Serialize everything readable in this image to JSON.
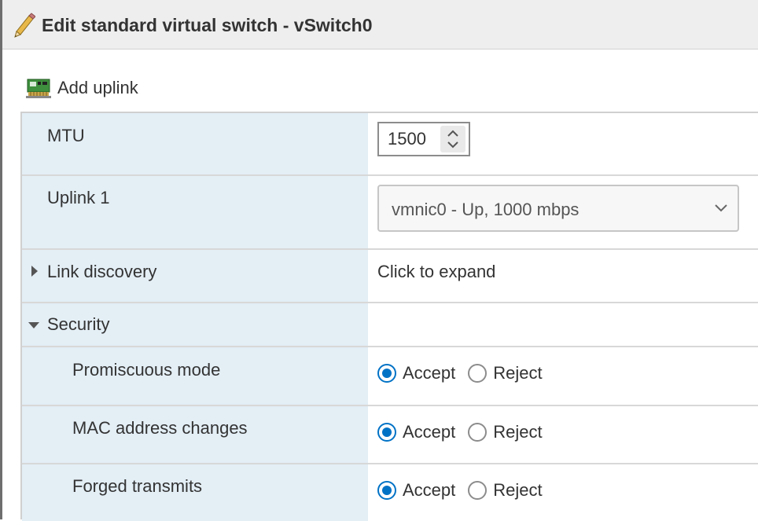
{
  "dialog": {
    "title": "Edit standard virtual switch - vSwitch0",
    "title_icon": "pencil-icon"
  },
  "toolbar": {
    "add_uplink_label": "Add uplink",
    "add_uplink_icon": "network-card-icon"
  },
  "settings": {
    "mtu": {
      "label": "MTU",
      "value": "1500"
    },
    "uplink1": {
      "label": "Uplink 1",
      "selected": "vmnic0 - Up, 1000 mbps"
    },
    "link_discovery": {
      "label": "Link discovery",
      "value": "Click to expand",
      "expanded": false
    },
    "security": {
      "label": "Security",
      "expanded": true,
      "rows": [
        {
          "label": "Promiscuous mode",
          "accept": "Accept",
          "reject": "Reject",
          "selected": "Accept"
        },
        {
          "label": "MAC address changes",
          "accept": "Accept",
          "reject": "Reject",
          "selected": "Accept"
        },
        {
          "label": "Forged transmits",
          "accept": "Accept",
          "reject": "Reject",
          "selected": "Accept"
        }
      ]
    }
  },
  "colors": {
    "label_cell_bg": "#e3eef5",
    "accent": "#0072c6",
    "titlebar_bg": "#eeeeee"
  }
}
